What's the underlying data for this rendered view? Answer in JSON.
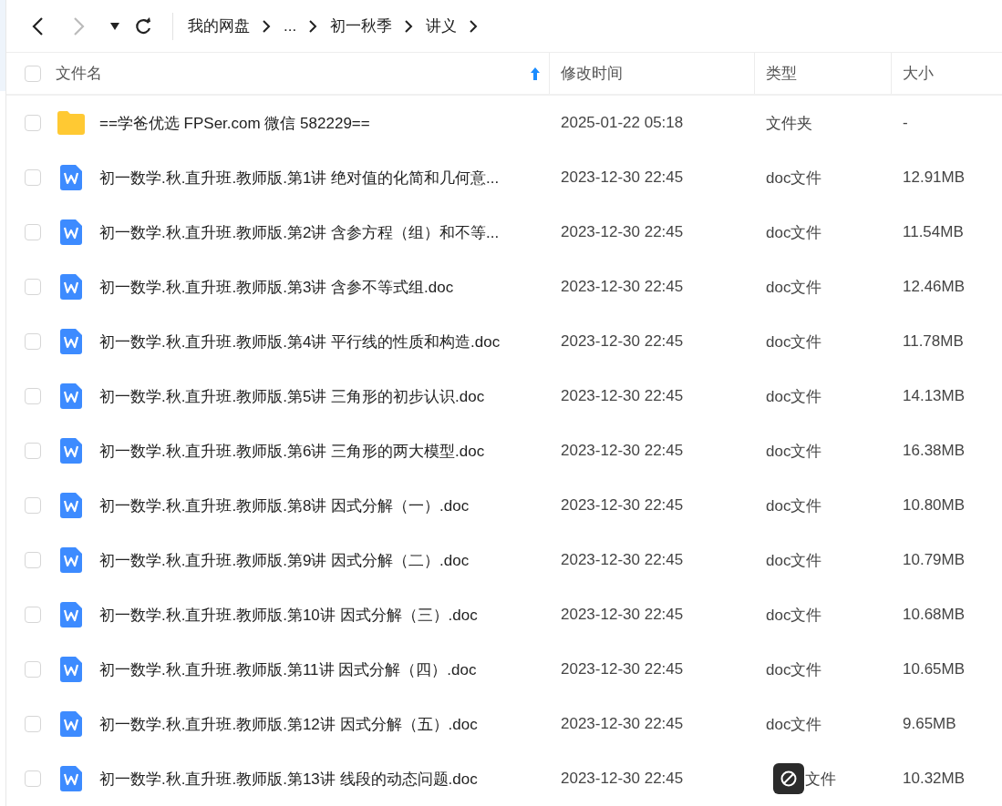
{
  "toolbar": {
    "breadcrumbs": [
      {
        "label": "我的网盘"
      },
      {
        "label": "..."
      },
      {
        "label": "初一秋季"
      },
      {
        "label": "讲义"
      }
    ]
  },
  "table": {
    "select_all": {
      "checked": false
    },
    "columns": [
      {
        "label": "文件名",
        "sorted": true
      },
      {
        "label": "修改时间",
        "sorted": false
      },
      {
        "label": "类型",
        "sorted": false
      },
      {
        "label": "大小",
        "sorted": false
      }
    ],
    "rows": [
      {
        "kind": "folder",
        "checked": false,
        "name": "==学爸优选 FPSer.com 微信 582229==",
        "modified": "2025-01-22 05:18",
        "type": "文件夹",
        "size": "-"
      },
      {
        "kind": "doc",
        "checked": false,
        "name": "初一数学.秋.直升班.教师版.第1讲  绝对值的化简和几何意...",
        "modified": "2023-12-30 22:45",
        "type": "doc文件",
        "size": "12.91MB"
      },
      {
        "kind": "doc",
        "checked": false,
        "name": "初一数学.秋.直升班.教师版.第2讲  含参方程（组）和不等...",
        "modified": "2023-12-30 22:45",
        "type": "doc文件",
        "size": "11.54MB"
      },
      {
        "kind": "doc",
        "checked": false,
        "name": "初一数学.秋.直升班.教师版.第3讲  含参不等式组.doc",
        "modified": "2023-12-30 22:45",
        "type": "doc文件",
        "size": "12.46MB"
      },
      {
        "kind": "doc",
        "checked": false,
        "name": "初一数学.秋.直升班.教师版.第4讲  平行线的性质和构造.doc",
        "modified": "2023-12-30 22:45",
        "type": "doc文件",
        "size": "11.78MB"
      },
      {
        "kind": "doc",
        "checked": false,
        "name": "初一数学.秋.直升班.教师版.第5讲  三角形的初步认识.doc",
        "modified": "2023-12-30 22:45",
        "type": "doc文件",
        "size": "14.13MB"
      },
      {
        "kind": "doc",
        "checked": false,
        "name": "初一数学.秋.直升班.教师版.第6讲  三角形的两大模型.doc",
        "modified": "2023-12-30 22:45",
        "type": "doc文件",
        "size": "16.38MB"
      },
      {
        "kind": "doc",
        "checked": false,
        "name": "初一数学.秋.直升班.教师版.第8讲  因式分解（一）.doc",
        "modified": "2023-12-30 22:45",
        "type": "doc文件",
        "size": "10.80MB"
      },
      {
        "kind": "doc",
        "checked": false,
        "name": "初一数学.秋.直升班.教师版.第9讲  因式分解（二）.doc",
        "modified": "2023-12-30 22:45",
        "type": "doc文件",
        "size": "10.79MB"
      },
      {
        "kind": "doc",
        "checked": false,
        "name": "初一数学.秋.直升班.教师版.第10讲  因式分解（三）.doc",
        "modified": "2023-12-30 22:45",
        "type": "doc文件",
        "size": "10.68MB"
      },
      {
        "kind": "doc",
        "checked": false,
        "name": "初一数学.秋.直升班.教师版.第11讲  因式分解（四）.doc",
        "modified": "2023-12-30 22:45",
        "type": "doc文件",
        "size": "10.65MB"
      },
      {
        "kind": "doc",
        "checked": false,
        "name": "初一数学.秋.直升班.教师版.第12讲  因式分解（五）.doc",
        "modified": "2023-12-30 22:45",
        "type": "doc文件",
        "size": "9.65MB"
      },
      {
        "kind": "doc",
        "checked": false,
        "name": "初一数学.秋.直升班.教师版.第13讲  线段的动态问题.doc",
        "modified": "2023-12-30 22:45",
        "type": "文件",
        "size": "10.32MB"
      }
    ]
  }
}
